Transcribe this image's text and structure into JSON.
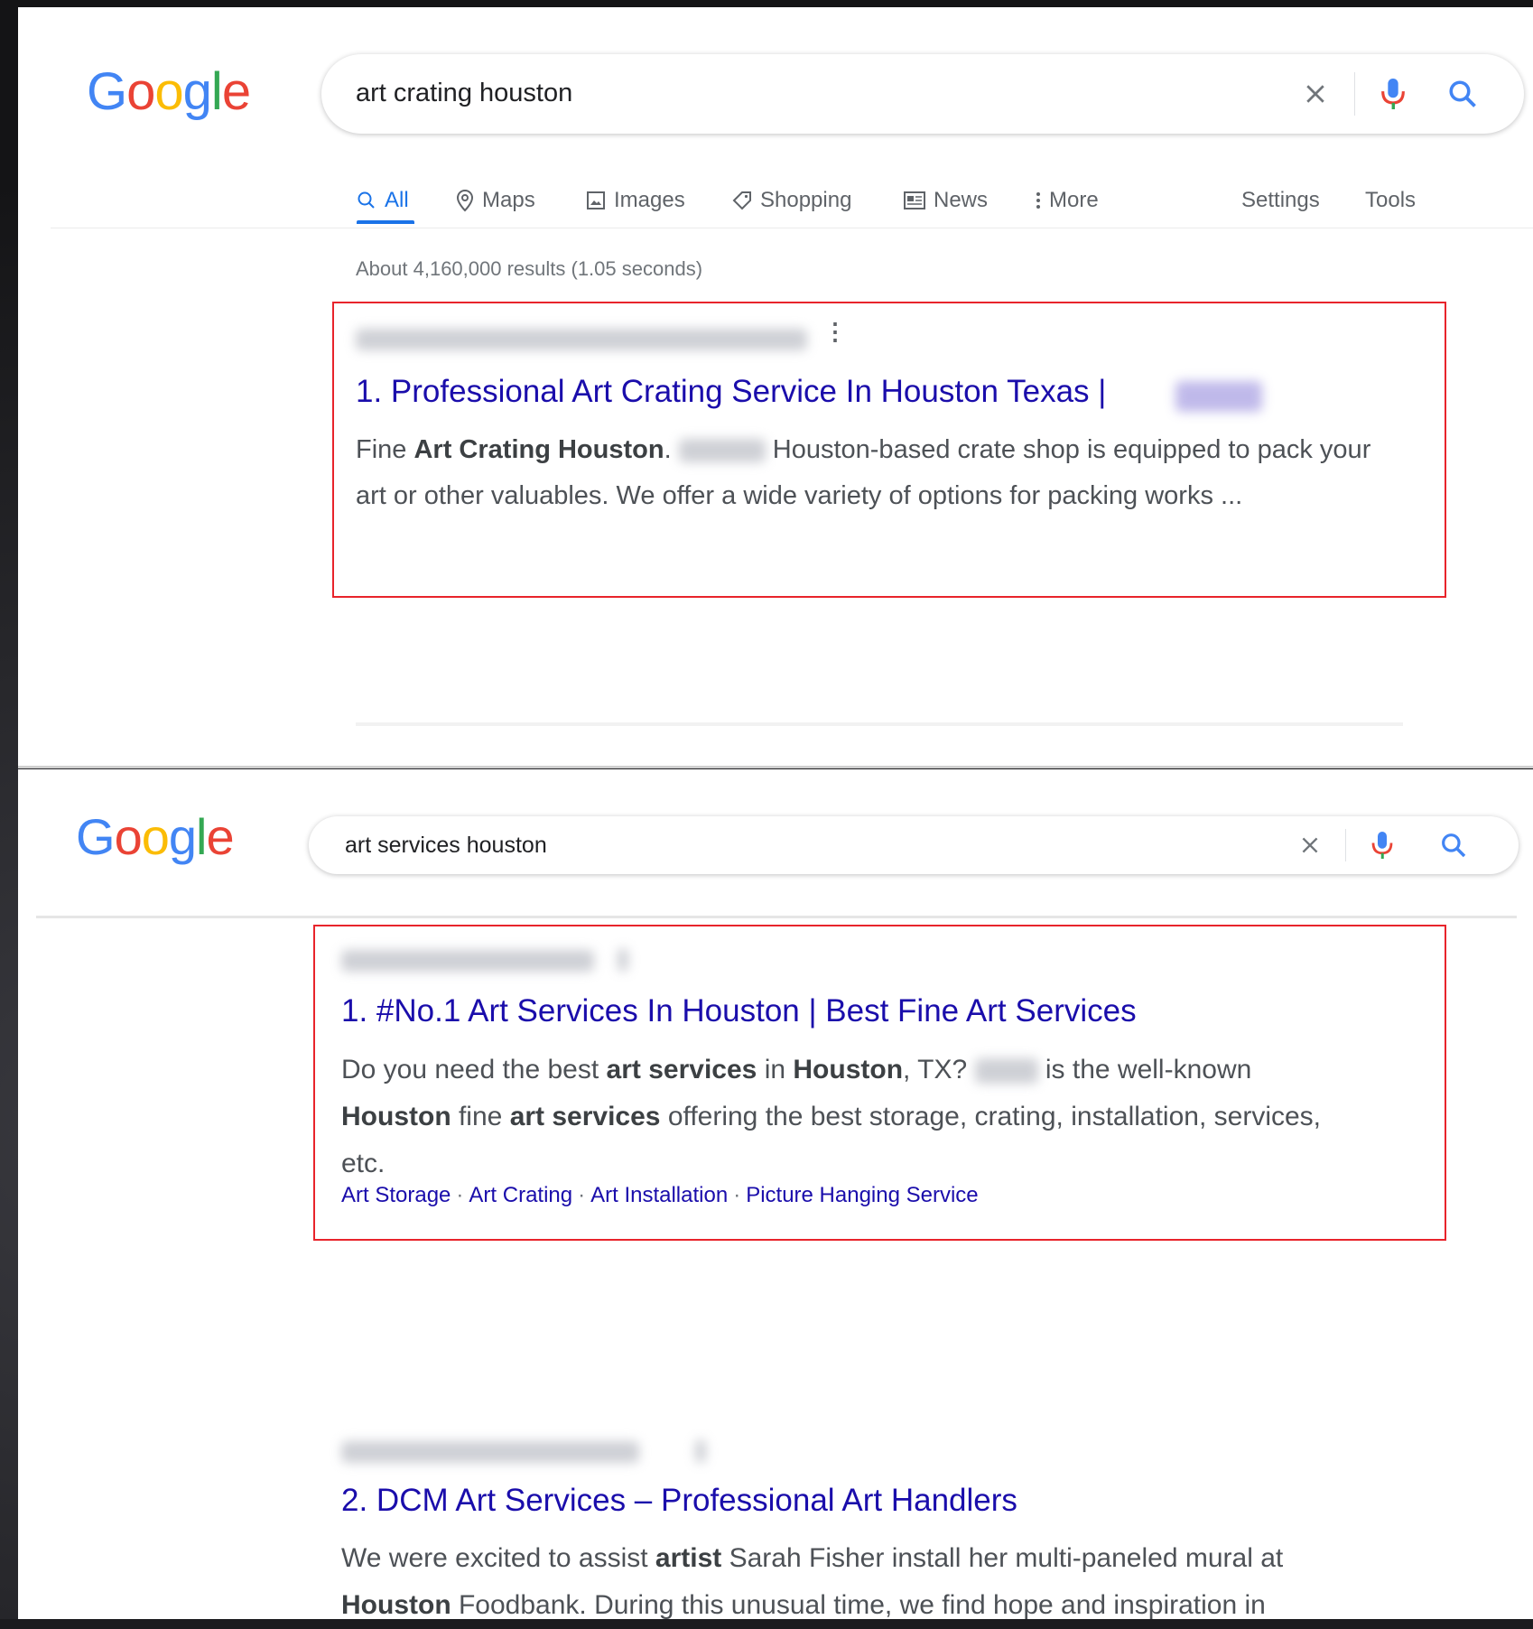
{
  "panel1": {
    "logo": "Google",
    "query": "art crating houston",
    "tabs": [
      {
        "label": "All",
        "icon": "search-icon"
      },
      {
        "label": "Maps",
        "icon": "map-pin-icon"
      },
      {
        "label": "Images",
        "icon": "image-icon"
      },
      {
        "label": "Shopping",
        "icon": "tag-icon"
      },
      {
        "label": "News",
        "icon": "news-icon"
      },
      {
        "label": "More",
        "icon": "more-vert-icon"
      },
      {
        "label": "Settings"
      },
      {
        "label": "Tools"
      }
    ],
    "stats": "About 4,160,000 results (1.05 seconds)",
    "result": {
      "title": "1. Professional Art Crating Service In Houston Texas |",
      "snippet_parts": [
        "Fine ",
        "Art Crating Houston",
        ".",
        "Houston-based crate shop is equipped to pack your art or other valuables. We offer a wide variety of options for packing works ..."
      ]
    }
  },
  "panel2": {
    "logo": "Google",
    "query": "art services houston",
    "result1": {
      "title": "1. #No.1 Art Services In Houston | Best Fine Art Services",
      "snippet_parts": [
        "Do you need the best ",
        "art services",
        " in ",
        "Houston",
        ", TX? ",
        "is the well-known",
        "Houston",
        " fine ",
        "art services",
        " offering the best storage, crating, installation, services, etc."
      ],
      "sitelinks": [
        "Art Storage",
        "Art Crating",
        "Art Installation",
        "Picture Hanging Service"
      ]
    },
    "result2": {
      "title": "2. DCM Art Services – Professional Art Handlers",
      "snippet_parts": [
        "We were excited to assist ",
        "artist",
        " Sarah Fisher install her multi-paneled mural at",
        "Houston",
        " Foodbank. During this unusual time, we find hope and inspiration in"
      ]
    }
  },
  "colors": {
    "link": "#1a0dab",
    "accent": "#1a73e8",
    "highlight_box": "#e8242b",
    "snippet": "#4d5156"
  }
}
